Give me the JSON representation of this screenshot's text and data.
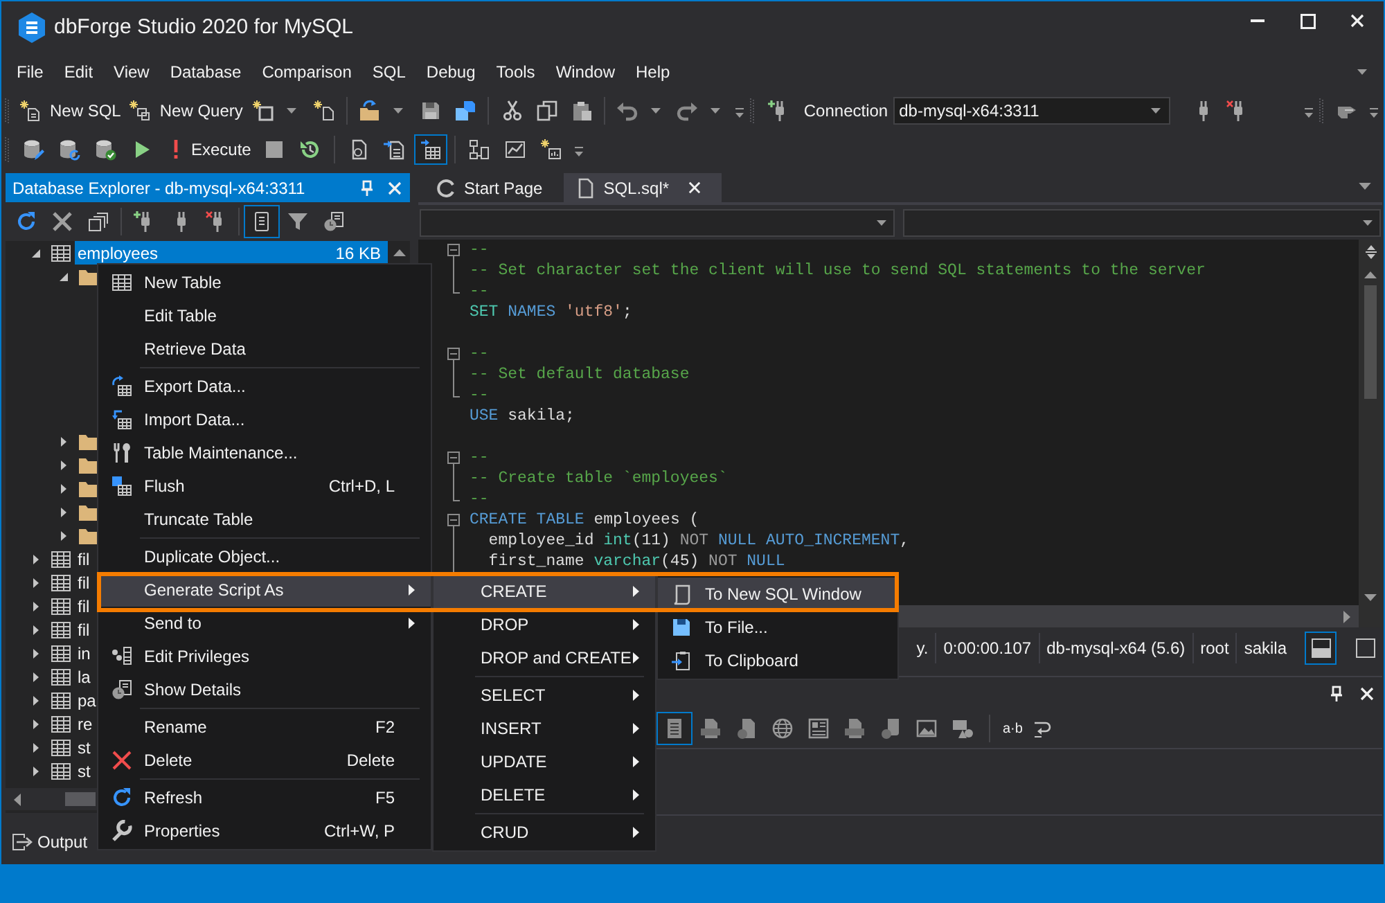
{
  "window": {
    "title": "dbForge Studio 2020 for MySQL"
  },
  "menu_bar": [
    "File",
    "Edit",
    "View",
    "Database",
    "Comparison",
    "SQL",
    "Debug",
    "Tools",
    "Window",
    "Help"
  ],
  "toolbar_1": [
    {
      "kind": "grip"
    },
    {
      "kind": "button",
      "label": "New SQL"
    },
    {
      "kind": "button",
      "label": "New Query"
    },
    {
      "kind": "split"
    },
    {
      "kind": "icon"
    },
    {
      "kind": "separator"
    },
    {
      "kind": "split"
    },
    {
      "kind": "icon"
    },
    {
      "kind": "icon"
    },
    {
      "kind": "separator"
    },
    {
      "kind": "icon"
    },
    {
      "kind": "icon"
    },
    {
      "kind": "icon"
    },
    {
      "kind": "separator"
    },
    {
      "kind": "split"
    },
    {
      "kind": "split"
    },
    {
      "kind": "overflow"
    },
    {
      "kind": "grip"
    },
    {
      "kind": "icon"
    },
    {
      "kind": "label",
      "text": "Connection"
    },
    {
      "kind": "combo",
      "value": "db-mysql-x64:3311"
    },
    {
      "kind": "icon"
    },
    {
      "kind": "icon"
    },
    {
      "kind": "overflow"
    },
    {
      "kind": "grip"
    },
    {
      "kind": "icon"
    },
    {
      "kind": "overflow"
    }
  ],
  "toolbar_2": [
    {
      "kind": "grip"
    },
    {
      "kind": "icon"
    },
    {
      "kind": "icon"
    },
    {
      "kind": "icon"
    },
    {
      "kind": "icon"
    },
    {
      "kind": "button",
      "label": "Execute"
    },
    {
      "kind": "icon"
    },
    {
      "kind": "icon"
    },
    {
      "kind": "separator"
    },
    {
      "kind": "toggle",
      "selected": false
    },
    {
      "kind": "toggle",
      "selected": false
    },
    {
      "kind": "toggle",
      "selected": true
    },
    {
      "kind": "separator"
    },
    {
      "kind": "icon"
    },
    {
      "kind": "icon"
    },
    {
      "kind": "icon"
    },
    {
      "kind": "overflow"
    }
  ],
  "database_explorer": {
    "title": "Database Explorer - db-mysql-x64:3311",
    "toolbar": [
      {
        "kind": "icon"
      },
      {
        "kind": "icon"
      },
      {
        "kind": "icon"
      },
      {
        "kind": "separator"
      },
      {
        "kind": "icon"
      },
      {
        "kind": "icon"
      },
      {
        "kind": "icon"
      },
      {
        "kind": "separator"
      },
      {
        "kind": "toggle",
        "selected": true
      },
      {
        "kind": "icon"
      },
      {
        "kind": "icon"
      }
    ],
    "tree": [
      {
        "kind": "table",
        "label": "employees",
        "size": "16 KB",
        "expanded": true,
        "selected": true,
        "children": [
          {
            "kind": "folder",
            "expanded": true,
            "selected": false
          },
          {
            "kind": "folder",
            "expanded": false,
            "selected": false
          },
          {
            "kind": "folder",
            "expanded": false,
            "selected": false
          },
          {
            "kind": "folder",
            "expanded": false,
            "selected": false
          },
          {
            "kind": "folder",
            "expanded": false,
            "selected": false
          },
          {
            "kind": "folder",
            "expanded": false,
            "selected": false
          }
        ]
      },
      {
        "kind": "table",
        "label": "fil",
        "expanded": false,
        "selected": false
      },
      {
        "kind": "table",
        "label": "fil",
        "expanded": false,
        "selected": false
      },
      {
        "kind": "table",
        "label": "fil",
        "expanded": false,
        "selected": false
      },
      {
        "kind": "table",
        "label": "fil",
        "expanded": false,
        "selected": false
      },
      {
        "kind": "table",
        "label": "in",
        "expanded": false,
        "selected": false
      },
      {
        "kind": "table",
        "label": "la",
        "expanded": false,
        "selected": false
      },
      {
        "kind": "table",
        "label": "pa",
        "expanded": false,
        "selected": false
      },
      {
        "kind": "table",
        "label": "re",
        "expanded": false,
        "selected": false
      },
      {
        "kind": "table",
        "label": "st",
        "expanded": false,
        "selected": false
      },
      {
        "kind": "table",
        "label": "st",
        "expanded": false,
        "selected": false
      }
    ]
  },
  "document_tabs": [
    {
      "label": "Start Page",
      "selected": false
    },
    {
      "label": "SQL.sql*",
      "selected": true
    }
  ],
  "editor": {
    "lines": [
      {
        "kind": "head",
        "tokens": [
          {
            "kind": "comment",
            "text": "--"
          }
        ]
      },
      {
        "kind": "body",
        "tokens": [
          {
            "kind": "comment",
            "text": "-- Set character set the client will use to send SQL statements to the server"
          }
        ]
      },
      {
        "kind": "tail",
        "tokens": [
          {
            "kind": "comment",
            "text": "--"
          }
        ]
      },
      {
        "kind": "code",
        "tokens": [
          {
            "kind": "builtin",
            "text": "SET "
          },
          {
            "kind": "keyword",
            "text": "NAMES "
          },
          {
            "kind": "string",
            "text": "'utf8'"
          },
          {
            "kind": "plain",
            "text": ";"
          }
        ]
      },
      {
        "kind": "blank"
      },
      {
        "kind": "head",
        "tokens": [
          {
            "kind": "comment",
            "text": "--"
          }
        ]
      },
      {
        "kind": "body",
        "tokens": [
          {
            "kind": "comment",
            "text": "-- Set default database"
          }
        ]
      },
      {
        "kind": "tail",
        "tokens": [
          {
            "kind": "comment",
            "text": "--"
          }
        ]
      },
      {
        "kind": "code",
        "tokens": [
          {
            "kind": "keyword",
            "text": "USE"
          },
          {
            "kind": "plain",
            "text": " sakila;"
          }
        ]
      },
      {
        "kind": "blank"
      },
      {
        "kind": "head",
        "tokens": [
          {
            "kind": "comment",
            "text": "--"
          }
        ]
      },
      {
        "kind": "body",
        "tokens": [
          {
            "kind": "comment",
            "text": "-- Create table `employees`"
          }
        ]
      },
      {
        "kind": "tail",
        "tokens": [
          {
            "kind": "comment",
            "text": "--"
          }
        ]
      },
      {
        "kind": "head",
        "tokens": [
          {
            "kind": "keyword",
            "text": "CREATE TABLE"
          },
          {
            "kind": "plain",
            "text": " employees ("
          }
        ]
      },
      {
        "kind": "body",
        "tokens": [
          {
            "kind": "plain",
            "text": "  employee_id "
          },
          {
            "kind": "builtin",
            "text": "int"
          },
          {
            "kind": "plain",
            "text": "(11) "
          },
          {
            "kind": "operator",
            "text": "NOT "
          },
          {
            "kind": "keyword",
            "text": "NULL AUTO_INCREMENT"
          },
          {
            "kind": "plain",
            "text": ","
          }
        ]
      },
      {
        "kind": "body",
        "tokens": [
          {
            "kind": "plain",
            "text": "  first_name "
          },
          {
            "kind": "builtin",
            "text": "varchar"
          },
          {
            "kind": "plain",
            "text": "(45) "
          },
          {
            "kind": "operator",
            "text": "NOT "
          },
          {
            "kind": "keyword",
            "text": "NULL"
          }
        ]
      }
    ]
  },
  "editor_status": {
    "items": [
      "y.",
      "0:00:00.107",
      "db-mysql-x64 (5.6)",
      "root",
      "sakila"
    ],
    "layout_toggles": [
      {
        "selected": true
      },
      {
        "selected": false
      }
    ]
  },
  "output_panel": {
    "toolbar": [
      {
        "kind": "toggle",
        "selected": true
      },
      {
        "kind": "toggle",
        "selected": false
      },
      {
        "kind": "toggle",
        "selected": false
      },
      {
        "kind": "toggle",
        "selected": false
      },
      {
        "kind": "toggle",
        "selected": false
      },
      {
        "kind": "toggle",
        "selected": false
      },
      {
        "kind": "toggle",
        "selected": false
      },
      {
        "kind": "toggle",
        "selected": false
      },
      {
        "kind": "toggle",
        "selected": false
      },
      {
        "kind": "separator"
      },
      {
        "kind": "text",
        "label": "a·b"
      },
      {
        "kind": "icon"
      }
    ]
  },
  "bottom_tabs": [
    {
      "label": "Output"
    }
  ],
  "context_menu": {
    "items": [
      {
        "kind": "item",
        "label": "New Table",
        "selected": false
      },
      {
        "kind": "item",
        "label": "Edit Table",
        "selected": false
      },
      {
        "kind": "item",
        "label": "Retrieve Data",
        "selected": false
      },
      {
        "kind": "separator"
      },
      {
        "kind": "item",
        "label": "Export Data...",
        "selected": false
      },
      {
        "kind": "item",
        "label": "Import Data...",
        "selected": false
      },
      {
        "kind": "item",
        "label": "Table Maintenance...",
        "selected": false
      },
      {
        "kind": "item",
        "label": "Flush",
        "shortcut": "Ctrl+D, L",
        "selected": false
      },
      {
        "kind": "item",
        "label": "Truncate Table",
        "selected": false
      },
      {
        "kind": "separator"
      },
      {
        "kind": "item",
        "label": "Duplicate Object...",
        "selected": false
      },
      {
        "kind": "submenu",
        "label": "Generate Script As",
        "selected": true
      },
      {
        "kind": "submenu",
        "label": "Send to",
        "selected": false
      },
      {
        "kind": "item",
        "label": "Edit Privileges",
        "selected": false
      },
      {
        "kind": "item",
        "label": "Show Details",
        "selected": false
      },
      {
        "kind": "separator"
      },
      {
        "kind": "item",
        "label": "Rename",
        "shortcut": "F2",
        "selected": false
      },
      {
        "kind": "item",
        "label": "Delete",
        "shortcut": "Delete",
        "selected": false
      },
      {
        "kind": "separator"
      },
      {
        "kind": "item",
        "label": "Refresh",
        "shortcut": "F5",
        "selected": false
      },
      {
        "kind": "item",
        "label": "Properties",
        "shortcut": "Ctrl+W, P",
        "selected": false
      }
    ]
  },
  "script_submenu": {
    "items": [
      {
        "kind": "submenu",
        "label": "CREATE",
        "selected": true
      },
      {
        "kind": "submenu",
        "label": "DROP",
        "selected": false
      },
      {
        "kind": "submenu",
        "label": "DROP and CREATE",
        "selected": false
      },
      {
        "kind": "separator"
      },
      {
        "kind": "submenu",
        "label": "SELECT",
        "selected": false
      },
      {
        "kind": "submenu",
        "label": "INSERT",
        "selected": false
      },
      {
        "kind": "submenu",
        "label": "UPDATE",
        "selected": false
      },
      {
        "kind": "submenu",
        "label": "DELETE",
        "selected": false
      },
      {
        "kind": "separator"
      },
      {
        "kind": "submenu",
        "label": "CRUD",
        "selected": false
      }
    ]
  },
  "create_submenu": {
    "items": [
      {
        "kind": "item",
        "label": "To New SQL Window",
        "selected": true
      },
      {
        "kind": "item",
        "label": "To File...",
        "selected": false
      },
      {
        "kind": "item",
        "label": "To Clipboard",
        "selected": false
      }
    ]
  }
}
